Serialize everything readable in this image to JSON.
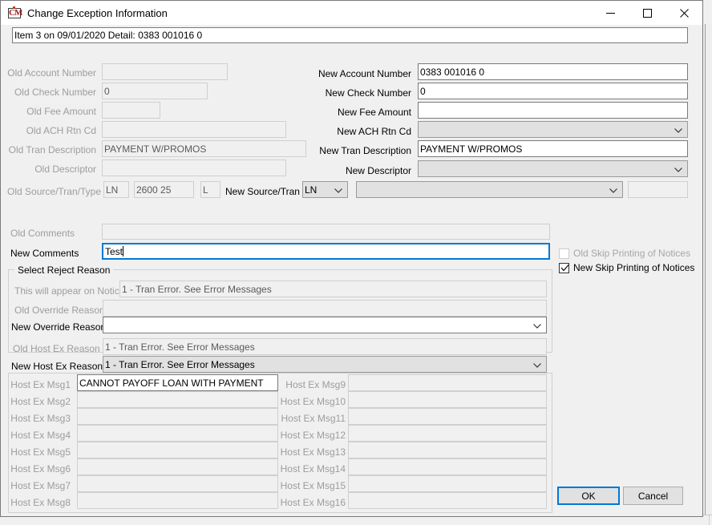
{
  "window": {
    "title": "Change Exception Information",
    "icon": "cm-app-icon",
    "minimize_label": "Minimize",
    "maximize_label": "Maximize",
    "close_label": "Close"
  },
  "header": {
    "item_detail": "Item 3 on 09/01/2020 Detail: 0383 001016 0"
  },
  "old_fields": [
    {
      "label": "Old Account Number",
      "value": ""
    },
    {
      "label": "Old Check Number",
      "value": "0"
    },
    {
      "label": "Old Fee Amount",
      "value": ""
    },
    {
      "label": "Old ACH Rtn Cd",
      "value": ""
    },
    {
      "label": "Old Tran Description",
      "value": "PAYMENT W/PROMOS"
    },
    {
      "label": "Old Descriptor",
      "value": ""
    }
  ],
  "new_fields": [
    {
      "label": "New Account Number",
      "value": "0383 001016 0"
    },
    {
      "label": "New Check Number",
      "value": "0"
    },
    {
      "label": "New Fee Amount",
      "value": ""
    },
    {
      "label": "New ACH Rtn Cd",
      "value": ""
    },
    {
      "label": "New Tran Description",
      "value": "PAYMENT W/PROMOS"
    },
    {
      "label": "New Descriptor",
      "value": ""
    }
  ],
  "source_tran": {
    "old_label": "Old Source/Tran/Type",
    "old_source": "LN",
    "old_tran": "2600 25",
    "old_type": "L",
    "new_label": "New Source/Tran",
    "new_source": "LN",
    "new_tran": "",
    "new_type": ""
  },
  "comments": {
    "old_label": "Old Comments",
    "old_value": "",
    "new_label": "New Comments",
    "new_value": "Test"
  },
  "skip_printing": {
    "old_label": "Old Skip Printing of Notices",
    "old_checked": false,
    "new_label": "New Skip Printing of Notices",
    "new_checked": true
  },
  "reject_reason": {
    "group_title": "Select Reject Reason",
    "notices_label": "This will appear on Notices",
    "notices_value": "1 - Tran Error. See Error Messages",
    "old_override_label": "Old Override Reason",
    "old_override_value": "",
    "new_override_label": "New Override Reason",
    "new_override_value": ""
  },
  "host_ex": {
    "old_label": "Old Host Ex Reason",
    "old_value": "1 - Tran Error. See Error Messages",
    "new_label": "New Host Ex Reason",
    "new_value": "1 - Tran Error. See Error Messages"
  },
  "host_ex_msgs_left": [
    {
      "label": "Host Ex Msg1",
      "value": "CANNOT PAYOFF LOAN WITH PAYMENT"
    },
    {
      "label": "Host Ex Msg2",
      "value": ""
    },
    {
      "label": "Host Ex Msg3",
      "value": ""
    },
    {
      "label": "Host Ex Msg4",
      "value": ""
    },
    {
      "label": "Host Ex Msg5",
      "value": ""
    },
    {
      "label": "Host Ex Msg6",
      "value": ""
    },
    {
      "label": "Host Ex Msg7",
      "value": ""
    },
    {
      "label": "Host Ex Msg8",
      "value": ""
    }
  ],
  "host_ex_msgs_right": [
    {
      "label": "Host Ex Msg9",
      "value": ""
    },
    {
      "label": "Host Ex Msg10",
      "value": ""
    },
    {
      "label": "Host Ex Msg11",
      "value": ""
    },
    {
      "label": "Host Ex Msg12",
      "value": ""
    },
    {
      "label": "Host Ex Msg13",
      "value": ""
    },
    {
      "label": "Host Ex Msg14",
      "value": ""
    },
    {
      "label": "Host Ex Msg15",
      "value": ""
    },
    {
      "label": "Host Ex Msg16",
      "value": ""
    }
  ],
  "buttons": {
    "ok": "OK",
    "cancel": "Cancel"
  },
  "colors": {
    "focus_blue": "#0078d7",
    "window_bg": "#f0f0f0",
    "field_border": "#7a7a7a",
    "disabled_text": "#9d9d9d"
  }
}
